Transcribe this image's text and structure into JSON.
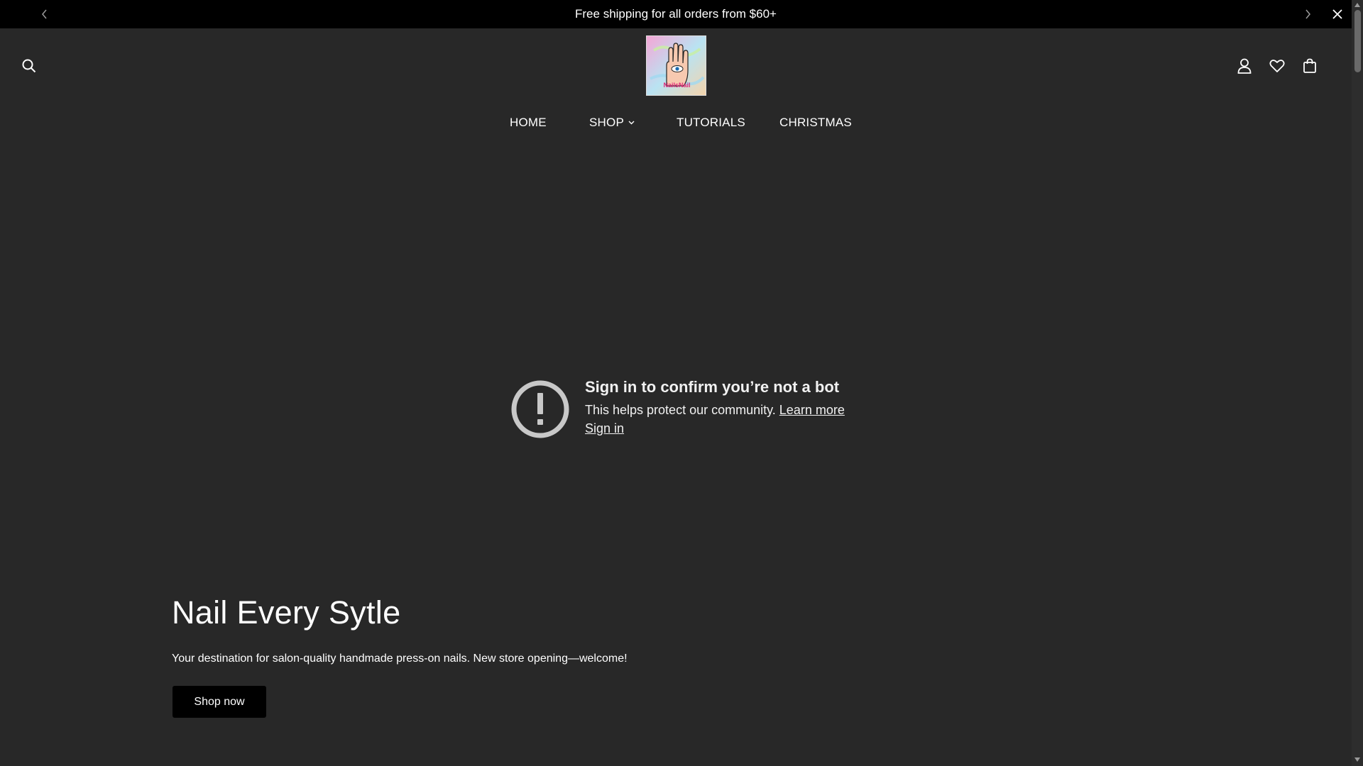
{
  "announcement": {
    "text": "Free shipping for all orders from $60+"
  },
  "logo": {
    "text": "NailsNail"
  },
  "nav": {
    "items": [
      {
        "label": "HOME"
      },
      {
        "label": "SHOP",
        "has_dropdown": true
      },
      {
        "label": "TUTORIALS"
      },
      {
        "label": "CHRISTMAS"
      }
    ]
  },
  "notice": {
    "title": "Sign in to confirm you’re not a bot",
    "description": "This helps protect our community.",
    "learn_more": "Learn more",
    "sign_in": "Sign in"
  },
  "hero": {
    "title": "Nail Every Sytle",
    "subtitle": "Your destination for salon-quality handmade press-on nails. New store opening—welcome!",
    "button_label": "Shop now"
  },
  "colors": {
    "page_bg": "#282828",
    "announcement_bg": "#000000",
    "button_bg": "#000000",
    "text": "#ffffff"
  },
  "icons": {
    "header_left": "search-icon",
    "header_right": [
      "account-icon",
      "wishlist-heart-icon",
      "cart-bag-icon"
    ],
    "announcement": [
      "chevron-left-icon",
      "chevron-right-icon",
      "close-icon"
    ],
    "notice": "alert-circle-icon"
  }
}
